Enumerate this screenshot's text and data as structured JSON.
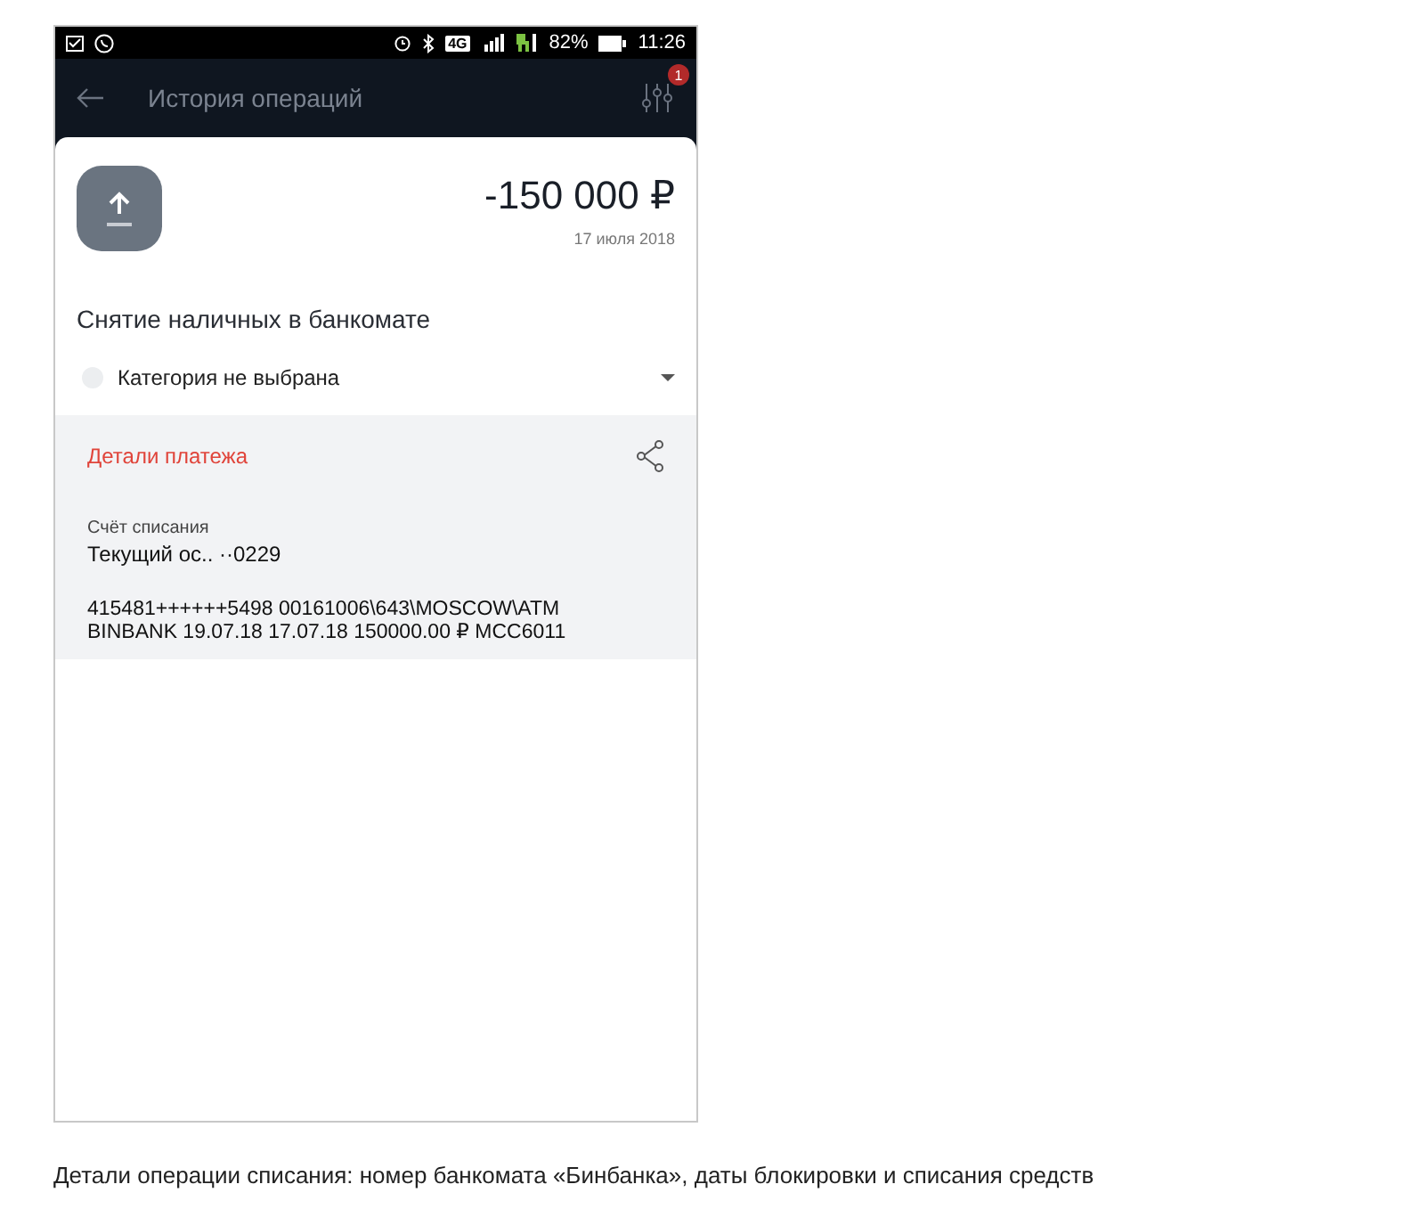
{
  "status_bar": {
    "network": "4G",
    "battery": "82%",
    "time": "11:26"
  },
  "header": {
    "title": "История операций",
    "filter_badge": "1"
  },
  "operation": {
    "amount": "-150 000 ₽",
    "date": "17 июля 2018",
    "description": "Снятие наличных в банкомате",
    "category": "Категория не выбрана"
  },
  "details": {
    "title": "Детали платежа",
    "account_label": "Счёт списания",
    "account_value": "Текущий ос.. ··0229",
    "text": "415481++++++5498 00161006\\643\\MOSCOW\\ATM BINBANK 19.07.18 17.07.18 150000.00 ₽ MCC6011"
  },
  "caption": "Детали операции списания: номер банкомата «Бинбанка», даты блокировки и списания средств"
}
